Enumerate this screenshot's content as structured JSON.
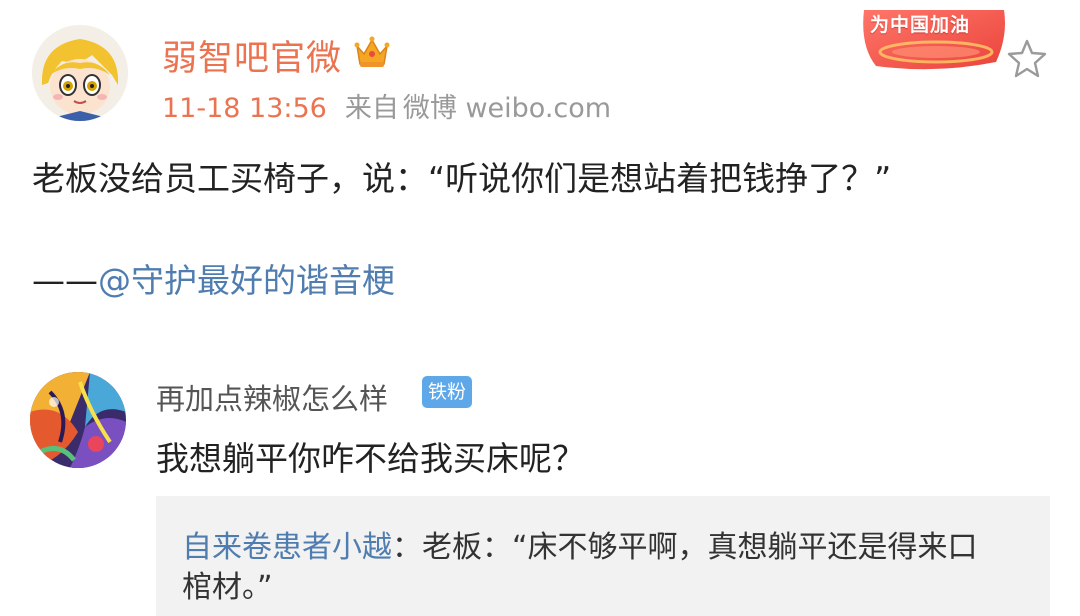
{
  "post": {
    "author": "弱智吧官微",
    "author_icon": "crown-vip-icon",
    "time": "11-18 13:56",
    "source_prefix": "来自",
    "source": "微博 weibo.com",
    "badge": "为中国加油",
    "text": "老板没给员工买椅子，说：“听说你们是想站着把钱挣了？”",
    "signature_dash": "——",
    "mention": "@守护最好的谐音梗"
  },
  "comment": {
    "author": "再加点辣椒怎么样",
    "fan_badge": "铁粉",
    "text": "我想躺平你咋不给我买床呢？"
  },
  "reply": {
    "author": "自来卷患者小越",
    "separator": "：",
    "text_line1": "老板：“床不够平啊，真想躺平还是得来口",
    "text_line2": "棺材。”"
  },
  "colors": {
    "author_orange": "#eb7350",
    "link_blue": "#507daf",
    "fan_badge_blue": "#5ea8ea",
    "reply_bg": "#f2f2f2"
  }
}
